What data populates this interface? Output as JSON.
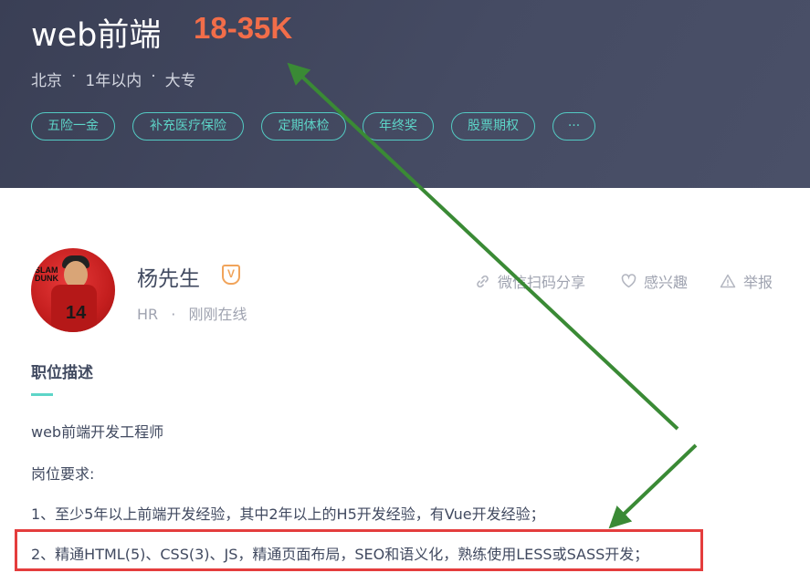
{
  "job": {
    "title": "web前端",
    "salary": "18-35K",
    "city": "北京",
    "experience": "1年以内",
    "education": "大专",
    "separator": "·",
    "tags": [
      "五险一金",
      "补充医疗保险",
      "定期体检",
      "年终奖",
      "股票期权",
      "···"
    ]
  },
  "hr": {
    "name": "杨先生",
    "badge": "V",
    "role": "HR",
    "separator": "·",
    "status": "刚刚在线"
  },
  "actions": {
    "share": "微信扫码分享",
    "interest": "感兴趣",
    "report": "举报"
  },
  "description": {
    "title": "职位描述",
    "lines": [
      "web前端开发工程师",
      "岗位要求:",
      "1、至少5年以上前端开发经验，其中2年以上的H5开发经验，有Vue开发经验；",
      "2、精通HTML(5)、CSS(3)、JS，精通页面布局，SEO和语义化，熟练使用LESS或SASS开发；"
    ]
  },
  "colors": {
    "header_bg": "#40465c",
    "salary": "#f26d49",
    "tag": "#5dd5c8",
    "highlight_box": "#e43d3d",
    "annotation_arrow": "#3a8a35",
    "badge": "#f1a45b"
  },
  "icons": [
    "link-icon",
    "heart-icon",
    "warning-icon",
    "arrow-annotation-icon"
  ]
}
